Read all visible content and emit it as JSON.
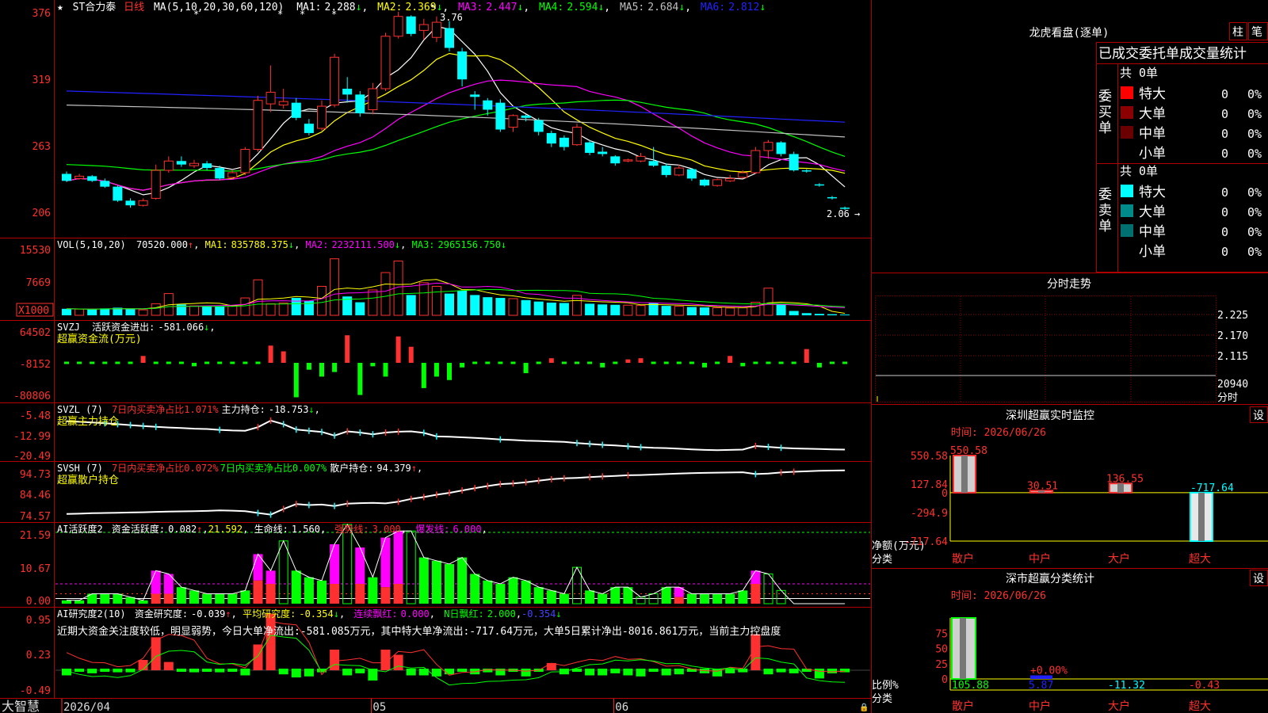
{
  "window": {
    "app_name": "大智慧"
  },
  "main": {
    "header": {
      "stock": "ST合力泰",
      "period": "日线",
      "ma_params": "MA(5,10,20,30,60,120)"
    },
    "ma": [
      {
        "label": "MA1:",
        "value": "2.288",
        "color": "#ffffff"
      },
      {
        "label": "MA2:",
        "value": "2.369",
        "color": "#ffff00"
      },
      {
        "label": "MA3:",
        "value": "2.447",
        "color": "#ff00ff"
      },
      {
        "label": "MA4:",
        "value": "2.594",
        "color": "#00ff00"
      },
      {
        "label": "MA5:",
        "value": "2.684",
        "color": "#c0c0c0"
      },
      {
        "label": "MA6:",
        "value": "2.812",
        "color": "#2222ff"
      }
    ],
    "yaxis": [
      "376",
      "319",
      "263",
      "206"
    ],
    "ann_high": "3.76",
    "ann_low": "2.06",
    "ylim": [
      1.85,
      3.82
    ],
    "candles": [
      [
        2.37,
        2.31,
        2.39,
        2.3
      ],
      [
        2.33,
        2.35,
        2.37,
        2.32
      ],
      [
        2.35,
        2.31,
        2.36,
        2.3
      ],
      [
        2.31,
        2.26,
        2.33,
        2.25
      ],
      [
        2.26,
        2.14,
        2.27,
        2.13
      ],
      [
        2.14,
        2.1,
        2.16,
        2.08
      ],
      [
        2.1,
        2.14,
        2.16,
        2.09
      ],
      [
        2.16,
        2.4,
        2.45,
        2.15
      ],
      [
        2.4,
        2.48,
        2.52,
        2.38
      ],
      [
        2.48,
        2.45,
        2.52,
        2.43
      ],
      [
        2.44,
        2.46,
        2.49,
        2.42
      ],
      [
        2.46,
        2.42,
        2.48,
        2.4
      ],
      [
        2.42,
        2.33,
        2.44,
        2.32
      ],
      [
        2.34,
        2.38,
        2.4,
        2.33
      ],
      [
        2.38,
        2.58,
        2.6,
        2.36
      ],
      [
        2.58,
        3.0,
        3.04,
        2.56
      ],
      [
        2.97,
        3.07,
        3.3,
        2.9
      ],
      [
        2.96,
        2.99,
        3.1,
        2.93
      ],
      [
        2.98,
        2.85,
        3.02,
        2.83
      ],
      [
        2.8,
        2.72,
        2.84,
        2.7
      ],
      [
        2.76,
        2.95,
        3.0,
        2.74
      ],
      [
        2.96,
        3.37,
        3.4,
        2.94
      ],
      [
        3.1,
        3.05,
        3.2,
        2.98
      ],
      [
        3.05,
        2.89,
        3.08,
        2.86
      ],
      [
        2.92,
        3.1,
        3.15,
        2.88
      ],
      [
        3.1,
        3.55,
        3.58,
        3.08
      ],
      [
        3.55,
        3.72,
        3.76,
        3.53
      ],
      [
        3.72,
        3.57,
        3.73,
        3.55
      ],
      [
        3.6,
        3.65,
        3.7,
        3.52
      ],
      [
        3.54,
        3.67,
        3.72,
        3.5
      ],
      [
        3.62,
        3.45,
        3.68,
        3.42
      ],
      [
        3.42,
        3.18,
        3.45,
        3.12
      ],
      [
        3.05,
        3.03,
        3.08,
        2.92
      ],
      [
        3.0,
        2.92,
        3.02,
        2.87
      ],
      [
        2.98,
        2.75,
        3.01,
        2.73
      ],
      [
        2.77,
        2.87,
        2.88,
        2.73
      ],
      [
        2.87,
        2.85,
        2.88,
        2.82
      ],
      [
        2.83,
        2.73,
        2.85,
        2.7
      ],
      [
        2.72,
        2.63,
        2.74,
        2.6
      ],
      [
        2.68,
        2.6,
        2.7,
        2.57
      ],
      [
        2.62,
        2.77,
        2.8,
        2.61
      ],
      [
        2.64,
        2.55,
        2.66,
        2.53
      ],
      [
        2.56,
        2.54,
        2.6,
        2.52
      ],
      [
        2.52,
        2.46,
        2.53,
        2.44
      ],
      [
        2.48,
        2.49,
        2.5,
        2.47
      ],
      [
        2.48,
        2.52,
        2.55,
        2.47
      ],
      [
        2.48,
        2.44,
        2.6,
        2.43
      ],
      [
        2.44,
        2.36,
        2.46,
        2.34
      ],
      [
        2.36,
        2.42,
        2.45,
        2.35
      ],
      [
        2.41,
        2.33,
        2.42,
        2.31
      ],
      [
        2.32,
        2.27,
        2.33,
        2.26
      ],
      [
        2.27,
        2.32,
        2.33,
        2.26
      ],
      [
        2.31,
        2.33,
        2.36,
        2.3
      ],
      [
        2.34,
        2.38,
        2.4,
        2.33
      ],
      [
        2.38,
        2.57,
        2.6,
        2.37
      ],
      [
        2.57,
        2.64,
        2.66,
        2.5
      ],
      [
        2.64,
        2.54,
        2.65,
        2.52
      ],
      [
        2.54,
        2.4,
        2.56,
        2.39
      ],
      [
        2.4,
        2.39,
        2.41,
        2.38
      ],
      [
        2.28,
        2.27,
        2.29,
        2.26
      ],
      [
        2.17,
        2.16,
        2.18,
        2.15
      ],
      [
        2.08,
        2.07,
        2.09,
        2.06
      ]
    ]
  },
  "vol": {
    "header": {
      "name": "VOL(5,10,20)",
      "value": "70520.000"
    },
    "ma": [
      {
        "label": "MA1:",
        "value": "835788.375",
        "color": "#ffff00"
      },
      {
        "label": "MA2:",
        "value": "2232111.500",
        "color": "#ff00ff"
      },
      {
        "label": "MA3:",
        "value": "2965156.750",
        "color": "#00ff00"
      }
    ],
    "yaxis": [
      "15530",
      "7669"
    ],
    "unit_label": "X1000",
    "ymax": 17500,
    "values": [
      1800,
      1700,
      1600,
      1900,
      2100,
      1800,
      1500,
      3200,
      6000,
      3000,
      2600,
      2500,
      2400,
      2600,
      4800,
      9800,
      3200,
      3400,
      4800,
      4000,
      8000,
      15600,
      5200,
      3600,
      7000,
      11800,
      15000,
      5600,
      9000,
      8000,
      6000,
      6800,
      5600,
      5000,
      4800,
      4600,
      4200,
      3800,
      3500,
      3400,
      5500,
      3200,
      3000,
      2900,
      2800,
      2700,
      3500,
      2600,
      2500,
      2300,
      2200,
      2100,
      2000,
      2100,
      3600,
      7500,
      3000,
      1200,
      600,
      400,
      300,
      200
    ]
  },
  "svzj": {
    "header": {
      "name": "SVZJ",
      "label": "活跃资金进出:",
      "value": "-581.066"
    },
    "subtitle": "超赢资金流(万元)",
    "yaxis": [
      "64502",
      "-8152",
      "-80806"
    ],
    "values": [
      -2.0,
      -2.0,
      -2.0,
      -2.0,
      -2.0,
      -2.0,
      6.0,
      -2.0,
      -2.0,
      -2.0,
      -3.0,
      -2.0,
      -2.0,
      -2.0,
      -2.0,
      -2.0,
      15.0,
      10.0,
      -30.0,
      -6.0,
      -12.0,
      -8.0,
      24.0,
      -28.0,
      -3.0,
      -12.0,
      23.0,
      14.0,
      -22.0,
      -12.0,
      -15.0,
      -4.0,
      -2.0,
      -2.0,
      -2.0,
      -2.0,
      -9.0,
      -2.0,
      4.0,
      -2.0,
      -2.0,
      -2.0,
      -4.0,
      -2.0,
      3.0,
      4.0,
      -2.0,
      -2.0,
      -2.0,
      -2.0,
      -4.0,
      -2.0,
      6.0,
      -3.0,
      -2.0,
      -2.0,
      -2.0,
      -2.0,
      12.0,
      -4.0,
      -2.0,
      -2.0
    ]
  },
  "svzl": {
    "header": {
      "name": "SVZL (7)",
      "item1": "7日内买卖净占比1.071%",
      "label": "主力持仓:",
      "value": "-18.753"
    },
    "subtitle": "超赢主力持仓",
    "yaxis": [
      "-5.48",
      "-12.99",
      "-20.49"
    ],
    "ylim": [
      -22,
      -4
    ],
    "values": [
      -9.2,
      -9.4,
      -9.6,
      -9.9,
      -10.2,
      -10.5,
      -10.8,
      -11.1,
      -11.3,
      -11.5,
      -11.7,
      -11.8,
      -12.1,
      -12.3,
      -12.4,
      -11.2,
      -9.0,
      -10.2,
      -12.0,
      -12.4,
      -12.8,
      -14.0,
      -12.6,
      -13.0,
      -13.6,
      -13.0,
      -12.7,
      -12.6,
      -13.1,
      -14.3,
      -14.4,
      -14.6,
      -14.8,
      -15.0,
      -15.3,
      -15.5,
      -15.7,
      -15.8,
      -16.0,
      -16.1,
      -16.5,
      -16.8,
      -17.1,
      -17.3,
      -17.6,
      -17.9,
      -18.1,
      -18.2,
      -18.4,
      -18.6,
      -18.8,
      -18.9,
      -18.8,
      -18.7,
      -17.5,
      -17.8,
      -18.1,
      -18.3,
      -18.4,
      -18.5,
      -18.6,
      -18.7
    ]
  },
  "svsh": {
    "header": {
      "name": "SVSH (7)",
      "item1": "7日内买卖净占比0.072%",
      "item2": "7日内买卖净占比0.007%",
      "label": "散户持仓:",
      "value": "94.379"
    },
    "subtitle": "超赢散户持仓",
    "yaxis": [
      "94.73",
      "84.46",
      "74.57"
    ],
    "ylim": [
      73,
      97
    ],
    "values": [
      75.8,
      75.9,
      76.1,
      76.2,
      76.3,
      76.4,
      76.5,
      76.7,
      76.8,
      76.9,
      77.0,
      77.1,
      77.3,
      77.2,
      77.0,
      76.2,
      75.5,
      77.9,
      80.0,
      79.6,
      79.8,
      79.2,
      80.2,
      80.4,
      80.5,
      80.3,
      81.0,
      82.2,
      83.0,
      84.0,
      84.8,
      85.8,
      86.8,
      87.7,
      88.5,
      88.8,
      89.3,
      90.0,
      90.6,
      91.0,
      91.2,
      91.5,
      91.8,
      92.0,
      92.3,
      92.4,
      92.6,
      92.8,
      93.0,
      93.2,
      93.3,
      93.4,
      93.5,
      93.6,
      92.8,
      93.0,
      93.5,
      93.8,
      94.0,
      94.2,
      94.3,
      94.4
    ]
  },
  "ai_act": {
    "header": {
      "name": "AI活跃度2",
      "label1": "资金活跃度:",
      "value1": "0.082",
      "value1b": "21.592",
      "label2": "生命线:",
      "value2": "1.560",
      "label3": "强势线:",
      "value3": "3.000",
      "label4": "爆发线:",
      "value4": "6.000"
    },
    "yaxis": [
      "21.59",
      "10.67",
      "0.00"
    ],
    "ymax": 23.5,
    "bars": [
      [
        1,
        0,
        0
      ],
      [
        1,
        0,
        0
      ],
      [
        3,
        0,
        0
      ],
      [
        3,
        0,
        0
      ],
      [
        3,
        0,
        0
      ],
      [
        2,
        0,
        0
      ],
      [
        1,
        0,
        0
      ],
      [
        10,
        3,
        0
      ],
      [
        9,
        3,
        0
      ],
      [
        5,
        0,
        0
      ],
      [
        4,
        0,
        0
      ],
      [
        3,
        0,
        0
      ],
      [
        3,
        0,
        0
      ],
      [
        3,
        0,
        0
      ],
      [
        4,
        0,
        0
      ],
      [
        15,
        7,
        0
      ],
      [
        10,
        6,
        0
      ],
      [
        19,
        0,
        1
      ],
      [
        10,
        0,
        0
      ],
      [
        8,
        0,
        0
      ],
      [
        7,
        0,
        0
      ],
      [
        18,
        6,
        0
      ],
      [
        24,
        0,
        1
      ],
      [
        17,
        6,
        0
      ],
      [
        8,
        0,
        0
      ],
      [
        20,
        5,
        0
      ],
      [
        22,
        6,
        0
      ],
      [
        22,
        0,
        1
      ],
      [
        14,
        0,
        0
      ],
      [
        13,
        0,
        0
      ],
      [
        12,
        0,
        0
      ],
      [
        14,
        0,
        0
      ],
      [
        9,
        0,
        0
      ],
      [
        7,
        0,
        0
      ],
      [
        6,
        0,
        0
      ],
      [
        8,
        0,
        0
      ],
      [
        7,
        0,
        0
      ],
      [
        5,
        0,
        0
      ],
      [
        4,
        0,
        0
      ],
      [
        3,
        0,
        0
      ],
      [
        11,
        0,
        1
      ],
      [
        4,
        0,
        0
      ],
      [
        3,
        0,
        0
      ],
      [
        5,
        0,
        0
      ],
      [
        5,
        0,
        0
      ],
      [
        2,
        0,
        1
      ],
      [
        3,
        0,
        1
      ],
      [
        5,
        0,
        0
      ],
      [
        5,
        2,
        0
      ],
      [
        3,
        0,
        0
      ],
      [
        3,
        0,
        0
      ],
      [
        3,
        0,
        0
      ],
      [
        3,
        0,
        0
      ],
      [
        4,
        0,
        0
      ],
      [
        10,
        6,
        0
      ],
      [
        9,
        0,
        1
      ],
      [
        4,
        0,
        1
      ],
      [
        0,
        0,
        0
      ],
      [
        0,
        0,
        0
      ],
      [
        0,
        0,
        0
      ],
      [
        0,
        0,
        0
      ],
      [
        0,
        0,
        0
      ]
    ]
  },
  "ai_res": {
    "header": {
      "name": "AI研究度2(10)",
      "label1": "资金研究度:",
      "value1": "-0.039",
      "label2": "平均研究度:",
      "value2": "-0.354",
      "label3": "连续飘红:",
      "value3": "0.000",
      "label4": "N日飘红:",
      "value4": "2.000",
      "value5": "-0.354"
    },
    "message": "近期大资金关注度较低，明显弱势，今日大单净流出:-581.085万元，其中特大单净流出:-717.64万元，大单5日累计净出-8016.861万元，当前主力控盘度",
    "yaxis": [
      "0.95",
      "0.23",
      "-0.49"
    ],
    "values": [
      0.05,
      0.0,
      -0.03,
      0.0,
      -0.02,
      0.02,
      0.1,
      0.32,
      0.08,
      0.0,
      0.02,
      0.0,
      -0.02,
      0.0,
      -0.05,
      0.25,
      0.55,
      -0.04,
      -0.07,
      -0.06,
      -0.02,
      0.2,
      -0.05,
      -0.03,
      -0.1,
      0.2,
      0.15,
      -0.05,
      -0.05,
      -0.06,
      -0.04,
      0.0,
      -0.04,
      -0.02,
      -0.05,
      0.0,
      -0.06,
      0.0,
      0.07,
      -0.04,
      0.0,
      0.05,
      0.05,
      0.03,
      -0.05,
      0.06,
      0.0,
      -0.05,
      -0.04,
      0.0,
      -0.03,
      -0.06,
      0.03,
      -0.02,
      0.35,
      -0.04,
      -0.02,
      -0.03,
      0.0,
      -0.08,
      -0.03,
      -0.02
    ]
  },
  "xaxis": [
    {
      "label": "2026/04",
      "idx": 0
    },
    {
      "label": "05",
      "idx": 24
    },
    {
      "label": "06",
      "idx": 43
    }
  ],
  "right": {
    "longhu": {
      "title": "龙虎看盘(逐单)",
      "btn1": "柱",
      "btn2": "笔"
    },
    "order_table": {
      "title": "已成交委托单成交量统计",
      "buy": {
        "side": "委买单",
        "total": "共 0单",
        "rows": [
          {
            "name": "特大",
            "count": "0",
            "pct": "0%",
            "color": "#ff0000"
          },
          {
            "name": "大单",
            "count": "0",
            "pct": "0%",
            "color": "#8b0000"
          },
          {
            "name": "中单",
            "count": "0",
            "pct": "0%",
            "color": "#6b0000"
          },
          {
            "name": "小单",
            "count": "0",
            "pct": "0%",
            "color": ""
          }
        ]
      },
      "sell": {
        "side": "委卖单",
        "total": "共 0单",
        "rows": [
          {
            "name": "特大",
            "count": "0",
            "pct": "0%",
            "color": "#00ffff"
          },
          {
            "name": "大单",
            "count": "0",
            "pct": "0%",
            "color": "#008b8b"
          },
          {
            "name": "中单",
            "count": "0",
            "pct": "0%",
            "color": "#007070"
          },
          {
            "name": "小单",
            "count": "0",
            "pct": "0%",
            "color": ""
          }
        ]
      }
    },
    "intraday": {
      "title": "分时走势",
      "yaxis": [
        "2.225",
        "2.170",
        "2.115",
        "20940"
      ],
      "unit": "分时"
    },
    "sz_monitor": {
      "title": "深圳超赢实时监控",
      "btn": "设",
      "time_label": "时间: 2026/06/26",
      "yaxis": [
        "550.58",
        "127.84",
        "0",
        "-294.9",
        "-717.64"
      ],
      "ylabel": "净额(万元)",
      "xlabel_title": "分类",
      "ylim": [
        -717.64,
        550.58
      ],
      "categories": [
        "散户",
        "中户",
        "大户",
        "超大"
      ],
      "values": [
        550.58,
        30.51,
        136.55,
        -717.64
      ],
      "value_labels": [
        "550.58",
        "30.51",
        "136.55",
        "-717.64"
      ]
    },
    "sz_stats": {
      "title": "深市超赢分类统计",
      "btn": "设",
      "time_label": "时间: 2026/06/26",
      "yaxis": [
        "75",
        "50",
        "25",
        "0"
      ],
      "ylabel": "比例%",
      "xlabel_title": "分类",
      "ymax": 100,
      "categories": [
        "散户",
        "中户",
        "大户",
        "超大"
      ],
      "values": [
        105.88,
        5.87,
        -11.32,
        -0.43
      ],
      "value_labels": [
        "105.88",
        "5.87",
        "-11.32",
        "-0.43"
      ],
      "pct_label": "+0.00%"
    }
  }
}
